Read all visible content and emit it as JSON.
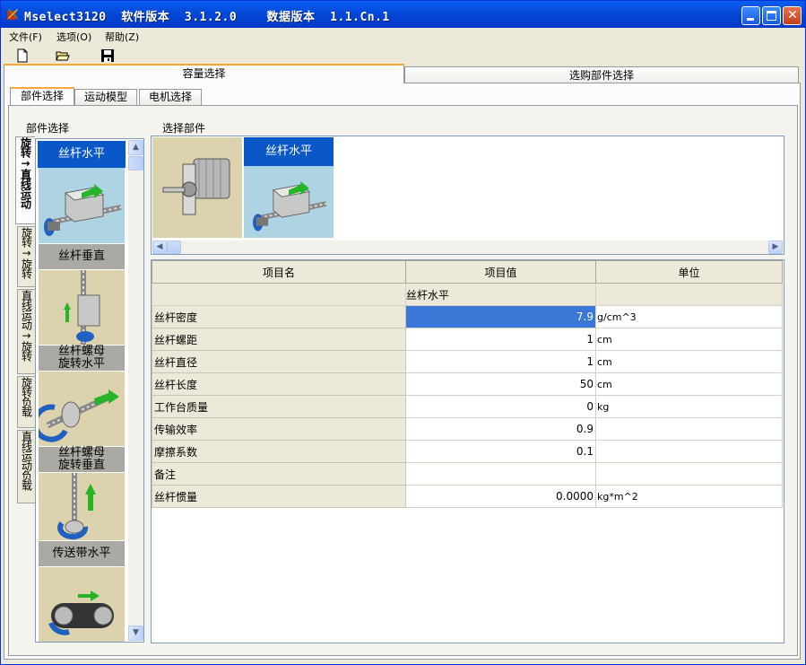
{
  "window": {
    "title": "Mselect3120  软件版本  3.1.2.0    数据版本  1.1.Cn.1"
  },
  "menu": {
    "items": [
      {
        "label": "文件(F)"
      },
      {
        "label": "选项(O)"
      },
      {
        "label": "帮助(Z)"
      }
    ]
  },
  "toolbar": {
    "icons": [
      "new-file-icon",
      "open-folder-icon",
      "save-icon"
    ]
  },
  "main_tabs": [
    {
      "label": "容量选择",
      "active": true
    },
    {
      "label": "选购部件选择",
      "active": false
    }
  ],
  "sub_tabs": [
    {
      "label": "部件选择",
      "active": true
    },
    {
      "label": "运动模型",
      "active": false
    },
    {
      "label": "电机选择",
      "active": false
    }
  ],
  "left_section_label": "部件选择",
  "right_section_label": "选择部件",
  "category_tabs": [
    {
      "label": "旋转→直线运动",
      "active": true
    },
    {
      "label": "旋转→旋转",
      "active": false
    },
    {
      "label": "直线运动→旋转",
      "active": false
    },
    {
      "label": "旋转负载",
      "active": false
    },
    {
      "label": "直线运动负载",
      "active": false
    }
  ],
  "components": [
    {
      "label": "丝杆水平",
      "selected": true
    },
    {
      "label": "丝杆垂直",
      "selected": false
    },
    {
      "label": "丝杆螺母\n旋转水平",
      "selected": false
    },
    {
      "label": "丝杆螺母\n旋转垂直",
      "selected": false
    },
    {
      "label": "传送带水平",
      "selected": false
    }
  ],
  "selected_parts": [
    {
      "label": "",
      "kind": "motor"
    },
    {
      "label": "丝杆水平",
      "kind": "ball-screw"
    }
  ],
  "grid": {
    "headers": [
      "项目名",
      "项目值",
      "单位"
    ],
    "group_label": "丝杆水平",
    "rows": [
      {
        "name": "丝杆密度",
        "value": "7.9",
        "unit": "g/cm^3",
        "selected": true
      },
      {
        "name": "丝杆螺距",
        "value": "1",
        "unit": "cm"
      },
      {
        "name": "丝杆直径",
        "value": "1",
        "unit": "cm"
      },
      {
        "name": "丝杆长度",
        "value": "50",
        "unit": "cm"
      },
      {
        "name": "工作台质量",
        "value": "0",
        "unit": "kg"
      },
      {
        "name": "传输效率",
        "value": "0.9",
        "unit": ""
      },
      {
        "name": "摩擦系数",
        "value": "0.1",
        "unit": ""
      },
      {
        "name": "备注",
        "value": "",
        "unit": ""
      },
      {
        "name": "丝杆惯量",
        "value": "0.0000",
        "unit": "kg*m^2"
      }
    ]
  },
  "colors": {
    "titlebar": "#0547d5",
    "selection": "#0a57c8",
    "tab_highlight": "#f7a83a",
    "face": "#ece9d8"
  }
}
